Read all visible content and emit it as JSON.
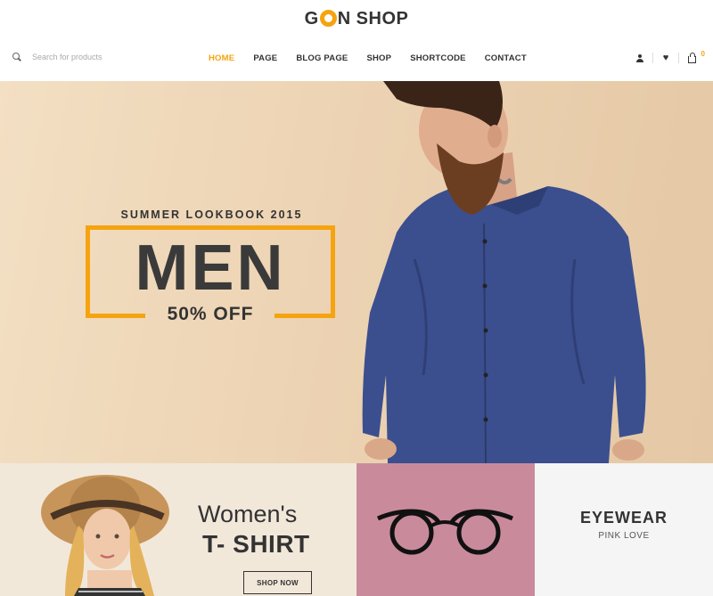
{
  "brand": {
    "part1": "G",
    "part2": "N",
    "part3": "SHOP",
    "accent_color": "#f5a40f"
  },
  "search": {
    "placeholder": "Search for products",
    "icon": "search-icon"
  },
  "nav": {
    "items": [
      {
        "label": "HOME",
        "active": true
      },
      {
        "label": "PAGE",
        "active": false
      },
      {
        "label": "BLOG PAGE",
        "active": false
      },
      {
        "label": "SHOP",
        "active": false
      },
      {
        "label": "SHORTCODE",
        "active": false
      },
      {
        "label": "CONTACT",
        "active": false
      }
    ]
  },
  "header_icons": {
    "user": "user-icon",
    "wishlist": "heart-icon",
    "cart": "cart-icon",
    "cart_count": "0"
  },
  "hero": {
    "kicker": "SUMMER LOOKBOOK 2015",
    "headline": "MEN",
    "discount": "50% OFF",
    "background": "#ecd3b3"
  },
  "banners": {
    "women": {
      "title": "Women's",
      "subtitle": "T- SHIRT",
      "button": "SHOP NOW",
      "background": "#f2e8da"
    },
    "glasses": {
      "background": "#c98b9c"
    },
    "eyewear": {
      "title": "EYEWEAR",
      "subtitle": "PINK LOVE",
      "background": "#f5f5f5"
    }
  }
}
